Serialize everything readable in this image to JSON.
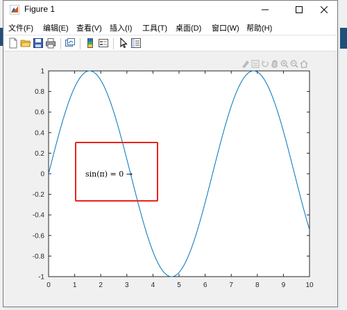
{
  "window": {
    "title": "Figure 1"
  },
  "menu": [
    {
      "label": "文件(F)"
    },
    {
      "label": "编辑(E)"
    },
    {
      "label": "查看(V)"
    },
    {
      "label": "插入(I)"
    },
    {
      "label": "工具(T)"
    },
    {
      "label": "桌面(D)"
    },
    {
      "label": "窗口(W)"
    },
    {
      "label": "帮助(H)"
    }
  ],
  "toolbar_icons": [
    "new-figure-icon",
    "open-file-icon",
    "save-icon",
    "print-icon",
    "link-plot-icon",
    "insert-colorbar-icon",
    "insert-legend-icon",
    "edit-plot-arrow-icon",
    "property-inspector-icon"
  ],
  "axes_toolbar_icons": [
    "brush-icon",
    "datatip-icon",
    "rotate-icon",
    "pan-icon",
    "zoom-in-icon",
    "zoom-out-icon",
    "home-icon"
  ],
  "colors": {
    "line": "#0072bd",
    "highlight_box": "#e8231c"
  },
  "chart_data": {
    "type": "line",
    "function": "sin(x)",
    "x_range": [
      0,
      10
    ],
    "ylim": [
      -1,
      1
    ],
    "xlim": [
      0,
      10
    ],
    "xticks": [
      "0",
      "1",
      "2",
      "3",
      "4",
      "5",
      "6",
      "7",
      "8",
      "9",
      "10"
    ],
    "yticks": [
      "1",
      "0.8",
      "0.6",
      "0.4",
      "0.2",
      "0",
      "-0.2",
      "-0.4",
      "-0.6",
      "-0.8",
      "-1"
    ],
    "annotation": "sin(π) = 0 →",
    "grid": false
  }
}
